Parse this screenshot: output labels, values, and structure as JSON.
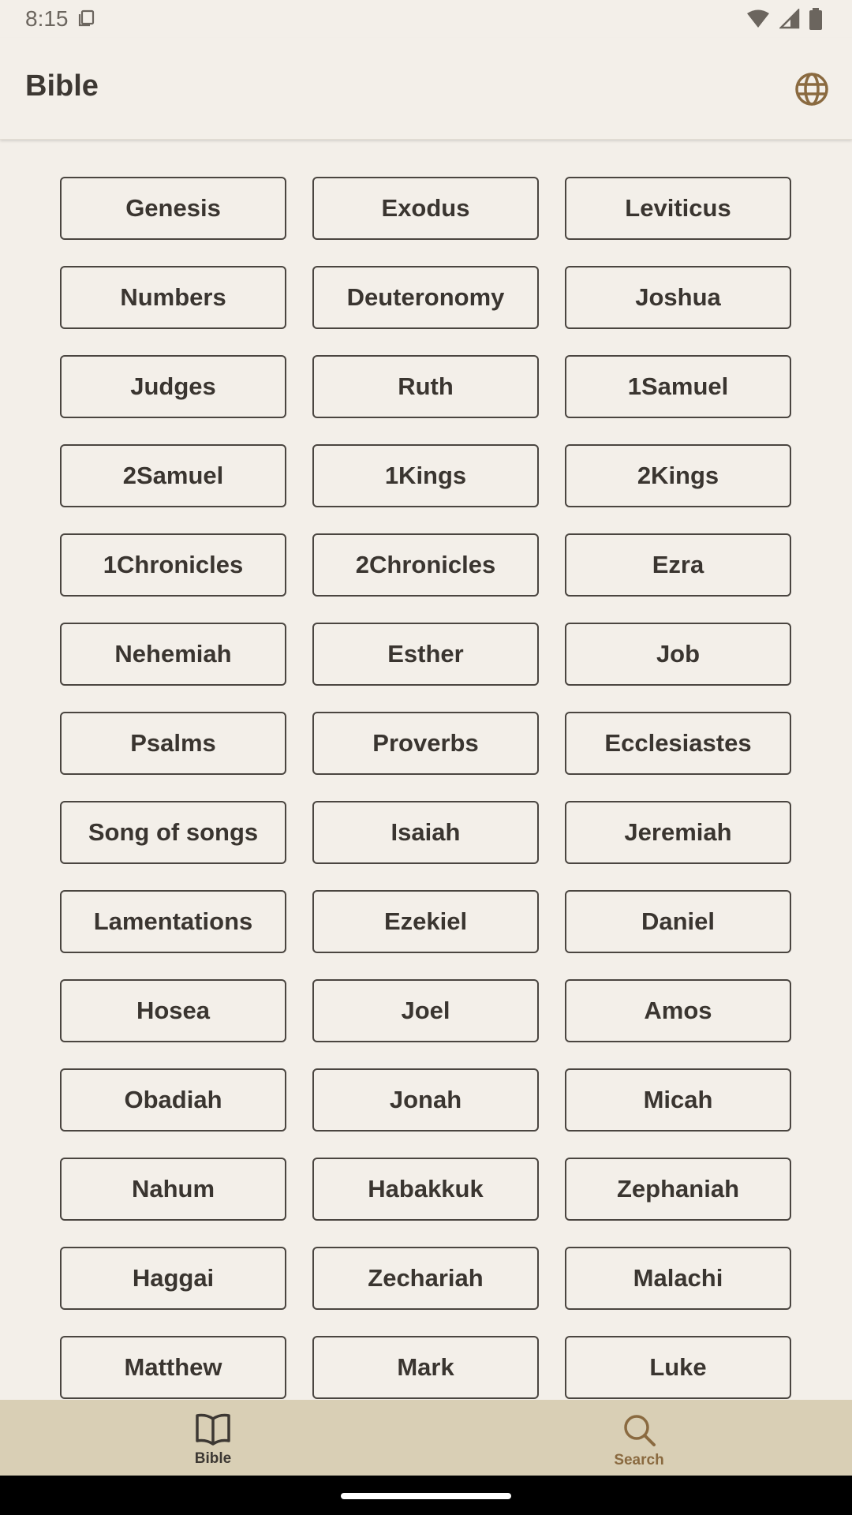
{
  "status_bar": {
    "time": "8:15"
  },
  "app_bar": {
    "title": "Bible",
    "language_icon": "globe-icon"
  },
  "books": [
    "Genesis",
    "Exodus",
    "Leviticus",
    "Numbers",
    "Deuteronomy",
    "Joshua",
    "Judges",
    "Ruth",
    "1Samuel",
    "2Samuel",
    "1Kings",
    "2Kings",
    "1Chronicles",
    "2Chronicles",
    "Ezra",
    "Nehemiah",
    "Esther",
    "Job",
    "Psalms",
    "Proverbs",
    "Ecclesiastes",
    "Song of songs",
    "Isaiah",
    "Jeremiah",
    "Lamentations",
    "Ezekiel",
    "Daniel",
    "Hosea",
    "Joel",
    "Amos",
    "Obadiah",
    "Jonah",
    "Micah",
    "Nahum",
    "Habakkuk",
    "Zephaniah",
    "Haggai",
    "Zechariah",
    "Malachi",
    "Matthew",
    "Mark",
    "Luke"
  ],
  "bottom_nav": {
    "items": [
      {
        "label": "Bible",
        "icon": "book-open-icon",
        "selected": true
      },
      {
        "label": "Search",
        "icon": "search-icon",
        "selected": false
      }
    ]
  },
  "colors": {
    "background": "#f3efe9",
    "bottom_nav": "#d9cfb5",
    "accent": "#8a6a40"
  }
}
